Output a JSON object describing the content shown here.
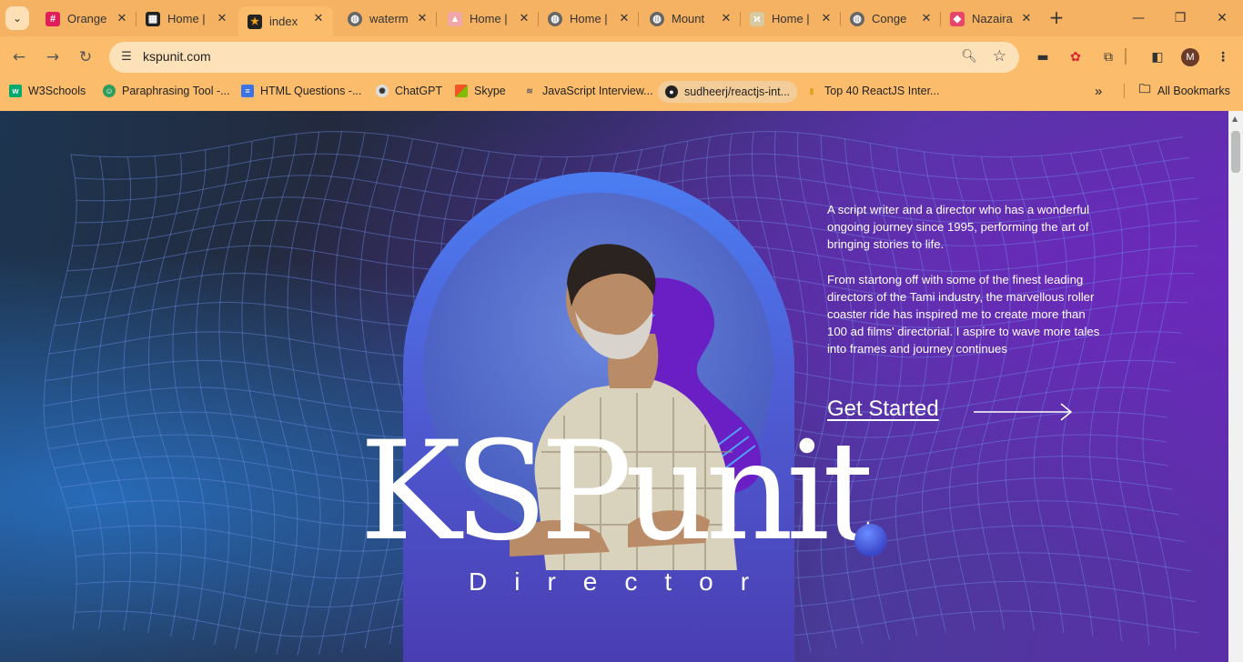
{
  "browser": {
    "tabs": [
      {
        "label": "Orange",
        "icon": "slack-icon"
      },
      {
        "label": "Home |",
        "icon": "grid-icon"
      },
      {
        "label": "index",
        "icon": "star-icon"
      },
      {
        "label": "waterm",
        "icon": "globe-icon"
      },
      {
        "label": "Home |",
        "icon": "tent-icon"
      },
      {
        "label": "Home |",
        "icon": "globe-icon"
      },
      {
        "label": "Mount",
        "icon": "globe-icon"
      },
      {
        "label": "Home |",
        "icon": "leaf-icon"
      },
      {
        "label": "Conge",
        "icon": "globe-icon"
      },
      {
        "label": "Nazaira",
        "icon": "diamond-icon"
      }
    ],
    "active_tab_index": 2,
    "url": "kspunit.com",
    "profile_initial": "M",
    "bookmarks": [
      {
        "label": "W3Schools",
        "icon": "w3schools-icon",
        "color": "#04aa6d"
      },
      {
        "label": "Paraphrasing Tool -...",
        "icon": "robot-icon",
        "color": "#2e9e5a"
      },
      {
        "label": "HTML Questions -...",
        "icon": "doc-icon",
        "color": "#3b73e6"
      },
      {
        "label": "ChatGPT",
        "icon": "chatgpt-icon",
        "color": "#444444"
      },
      {
        "label": "Skype",
        "icon": "windows-icon",
        "color": "#f35325"
      },
      {
        "label": "JavaScript Interview...",
        "icon": "wave-icon",
        "color": "#7a7a7a"
      },
      {
        "label": "sudheerj/reactjs-int...",
        "icon": "github-icon",
        "color": "#222222"
      },
      {
        "label": "Top 40 ReactJS Inter...",
        "icon": "bookmark-icon",
        "color": "#e0a020"
      }
    ],
    "all_bookmarks_label": "All Bookmarks"
  },
  "hero": {
    "intro_paragraph_1": "A script writer and a director who has a wonderful ongoing journey since 1995, performing the art of bringing stories to life.",
    "intro_paragraph_2": "From startong off with some of the finest leading directors of the Tami industry, the marvellous roller coaster ride has inspired me to create more than 100 ad films' directorial. I aspire to wave more tales into frames and journey continues",
    "cta_label": "Get Started",
    "logo_text": "KSPunit",
    "subtitle": "Director"
  },
  "colors": {
    "browser_frame": "#fbbd6b",
    "arch_blue": "#4b7ef2",
    "blob_purple": "#6a1fc4",
    "accent_dot": "#4a5ee8"
  }
}
